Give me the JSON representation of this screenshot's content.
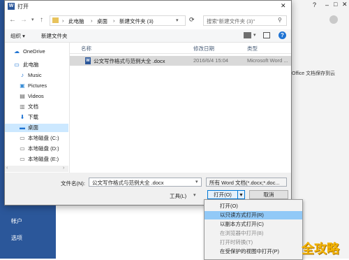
{
  "background": {
    "sidebar_items": [
      "帐户",
      "选项"
    ],
    "right_text": "Office 文档保存到云"
  },
  "dialog": {
    "title": "打开",
    "breadcrumb": [
      "此电脑",
      "桌面",
      "新建文件夹 (3)"
    ],
    "search_placeholder": "搜索\"新建文件夹 (3)\"",
    "toolbar": {
      "organize": "组织 ▾",
      "new_folder": "新建文件夹"
    },
    "nav": [
      {
        "icon": "cloud-icon",
        "glyph": "☁",
        "label": "OneDrive"
      },
      {
        "icon": "pc-icon",
        "glyph": "▭",
        "label": "此电脑"
      },
      {
        "icon": "music-icon",
        "glyph": "♪",
        "label": "Music"
      },
      {
        "icon": "pictures-icon",
        "glyph": "▣",
        "label": "Pictures"
      },
      {
        "icon": "videos-icon",
        "glyph": "▤",
        "label": "Videos"
      },
      {
        "icon": "documents-icon",
        "glyph": "▥",
        "label": "文档"
      },
      {
        "icon": "downloads-icon",
        "glyph": "⬇",
        "label": "下载"
      },
      {
        "icon": "desktop-icon",
        "glyph": "▬",
        "label": "桌面"
      },
      {
        "icon": "drive-icon",
        "glyph": "▭",
        "label": "本地磁盘 (C:)"
      },
      {
        "icon": "drive-icon",
        "glyph": "▭",
        "label": "本地磁盘 (D:)"
      },
      {
        "icon": "drive-icon",
        "glyph": "▭",
        "label": "本地磁盘 (E:)"
      }
    ],
    "columns": {
      "name": "名称",
      "date": "修改日期",
      "type": "类型"
    },
    "files": [
      {
        "name": "公文写作格式与范例大全 .docx",
        "date": "2016/6/4 15:04",
        "type": "Microsoft Word ..."
      }
    ],
    "filename_label": "文件名(N):",
    "filename_value": "公文写作格式与范例大全 .docx",
    "filetype_value": "所有 Word 文档(*.docx;*.doc...",
    "tools_label": "工具(L)",
    "open_button": "打开(O)",
    "cancel_button": "取消"
  },
  "menu": {
    "items": [
      {
        "label": "打开(O)",
        "state": "normal"
      },
      {
        "label": "以只读方式打开(R)",
        "state": "selected"
      },
      {
        "label": "以副本方式打开(C)",
        "state": "normal"
      },
      {
        "label": "在浏览器中打开(B)",
        "state": "disabled"
      },
      {
        "label": "打开时转换(T)",
        "state": "disabled"
      },
      {
        "label": "在受保护的视图中打开(P)",
        "state": "normal"
      }
    ]
  },
  "watermark": "全攻略",
  "colors": {
    "accent": "#0078d7",
    "selected_row": "#cce8ff",
    "menu_highlight": "#91c9f7",
    "word_blue": "#2b579a"
  }
}
